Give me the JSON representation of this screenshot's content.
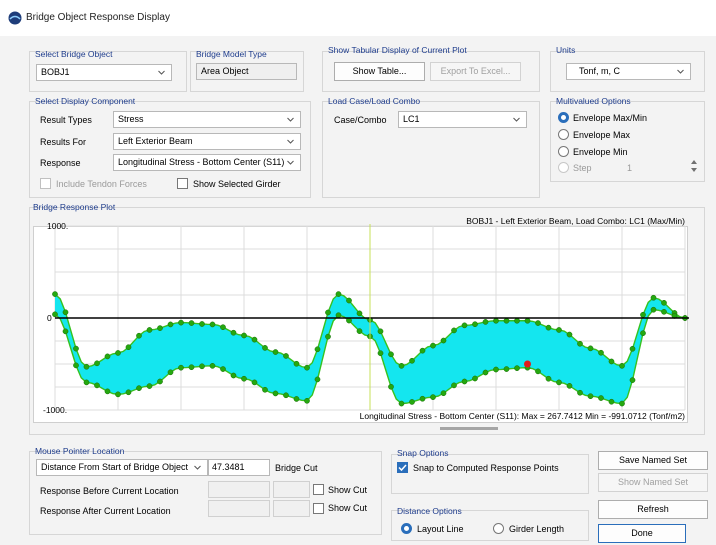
{
  "window": {
    "title": "Bridge Object Response Display"
  },
  "select_bridge_object": {
    "label": "Select Bridge Object",
    "value": "BOBJ1"
  },
  "bridge_model_type": {
    "label": "Bridge Model Type",
    "value": "Area Object"
  },
  "tabular": {
    "label": "Show Tabular Display of Current Plot",
    "show_table": "Show Table...",
    "export_excel": "Export To Excel..."
  },
  "units": {
    "label": "Units",
    "value": "Tonf, m, C"
  },
  "display_component": {
    "label": "Select Display Component",
    "result_types_label": "Result Types",
    "result_types_value": "Stress",
    "results_for_label": "Results For",
    "results_for_value": "Left Exterior Beam",
    "response_label": "Response",
    "response_value": "Longitudinal Stress - Bottom Center (S11)",
    "include_tendon": "Include Tendon Forces",
    "show_selected_girder": "Show Selected Girder"
  },
  "load_case": {
    "label": "Load Case/Load Combo",
    "case_label": "Case/Combo",
    "case_value": "LC1"
  },
  "multivalued": {
    "label": "Multivalued Options",
    "options": [
      "Envelope Max/Min",
      "Envelope Max",
      "Envelope Min"
    ],
    "selected": "Envelope Max/Min",
    "step_label": "Step",
    "step_value": "1"
  },
  "plot": {
    "label": "Bridge Response Plot",
    "header": "BOBJ1 - Left Exterior Beam,  Load Combo: LC1 (Max/Min)",
    "footer": "Longitudinal Stress - Bottom Center (S11):  Max = 267.7412   Min = -991.0712   (Tonf/m2)"
  },
  "chart_data": {
    "type": "area",
    "title": "BOBJ1 - Left Exterior Beam,  Load Combo: LC1 (Max/Min)",
    "ylabel": "",
    "xlabel": "",
    "ylim": [
      -1000,
      1000
    ],
    "y_ticks": [
      "1000.",
      "0",
      "-1000."
    ],
    "x": [
      0,
      10,
      20,
      30,
      40,
      50,
      60,
      70,
      80,
      90,
      100,
      110,
      120,
      130,
      140,
      150,
      160,
      170,
      180,
      190,
      200
    ],
    "series": [
      {
        "values": [
          260,
          -530,
          -380,
          -130,
          -50,
          -70,
          -190,
          -370,
          -540,
          260,
          -20,
          -520,
          -300,
          -80,
          -30,
          -30,
          -130,
          -330,
          -520,
          220,
          0
        ]
      },
      {
        "values": [
          40,
          -700,
          -830,
          -740,
          -540,
          -520,
          -660,
          -820,
          -900,
          30,
          -200,
          -930,
          -860,
          -690,
          -560,
          -540,
          -700,
          -850,
          -930,
          90,
          0
        ]
      }
    ],
    "marker_x": 100,
    "highlight_point": {
      "x": 150,
      "y": -500
    },
    "grid": true,
    "max": 267.7412,
    "min": -991.0712,
    "units": "Tonf/m2"
  },
  "mouse_pointer": {
    "label": "Mouse Pointer Location",
    "distance_combo": "Distance From Start of Bridge Object",
    "distance_value": "47.3481",
    "bridge_cut": "Bridge Cut",
    "before_label": "Response Before Current Location",
    "after_label": "Response After Current Location",
    "show_cut": "Show Cut"
  },
  "snap": {
    "label": "Snap Options",
    "snap_label": "Snap to Computed Response Points"
  },
  "distance": {
    "label": "Distance Options",
    "layout_line": "Layout Line",
    "girder_length": "Girder Length"
  },
  "buttons": {
    "save_named_set": "Save Named Set",
    "show_named_set": "Show Named Set",
    "refresh": "Refresh",
    "done": "Done"
  },
  "colors": {
    "fill": "#14e6ef",
    "line": "#36c21f",
    "marker": "#25a80f",
    "highlight": "#e21b1b",
    "accent": "#2a6ebb"
  }
}
